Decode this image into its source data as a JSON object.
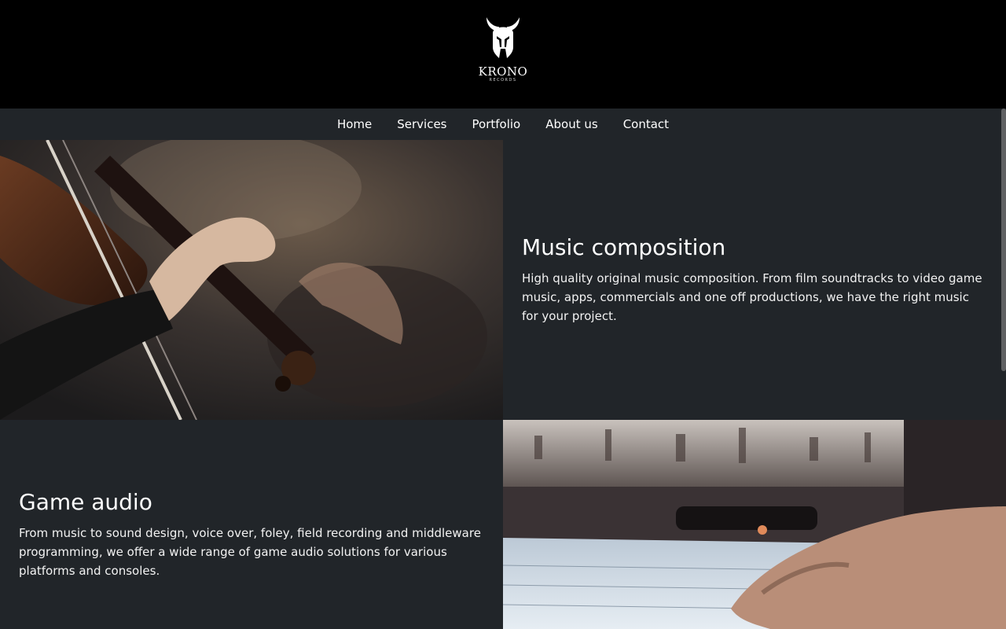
{
  "brand": {
    "name": "KRONO",
    "subtitle": "RECORDS",
    "logo_icon": "spartan-helmet-icon"
  },
  "nav": {
    "items": [
      {
        "label": "Home"
      },
      {
        "label": "Services"
      },
      {
        "label": "Portfolio"
      },
      {
        "label": "About us"
      },
      {
        "label": "Contact"
      }
    ]
  },
  "sections": [
    {
      "title": "Music composition",
      "text": "High quality original music composition. From film soundtracks to video game music, apps, commercials and one off productions, we have the right music for your project.",
      "image": "violin-player-photo"
    },
    {
      "title": "Game audio",
      "text": "From music to sound design, voice over, foley, field recording and middleware programming, we offer a wide range of game audio solutions for various platforms and consoles.",
      "image": "mixing-console-photo"
    }
  ],
  "colors": {
    "header_bg": "#000000",
    "page_bg": "#212529",
    "text": "#ffffff"
  }
}
